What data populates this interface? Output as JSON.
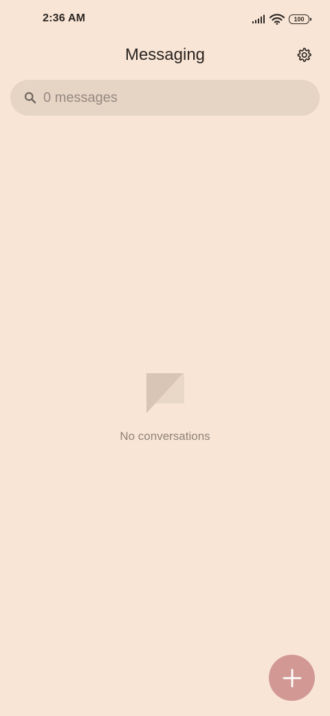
{
  "status_bar": {
    "time": "2:36 AM",
    "battery_level": "100",
    "icons": [
      "signal-icon",
      "wifi-icon",
      "battery-icon"
    ]
  },
  "header": {
    "title": "Messaging",
    "settings_icon": "gear-icon"
  },
  "search": {
    "placeholder": "0 messages",
    "icon": "search-icon"
  },
  "empty_state": {
    "icon": "chat-bubble-icon",
    "message": "No conversations"
  },
  "fab": {
    "icon": "plus-icon",
    "color": "#d29893"
  },
  "colors": {
    "background": "#f8e5d6",
    "search_background": "#e6d4c5",
    "accent": "#d29893"
  }
}
